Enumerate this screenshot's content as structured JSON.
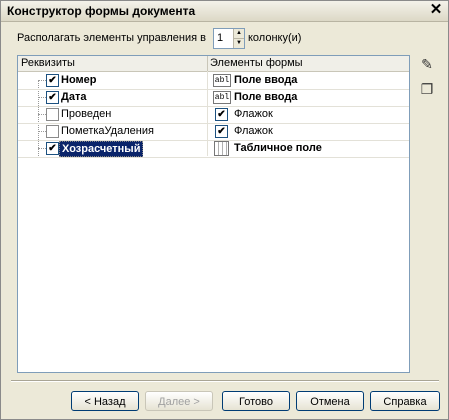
{
  "window": {
    "title": "Конструктор формы документа"
  },
  "arrange": {
    "prefix": "Располагать элементы управления в",
    "columns": "1",
    "suffix": "колонку(и)"
  },
  "grid": {
    "headers": {
      "attributes": "Реквизиты",
      "elements": "Элементы формы"
    },
    "rows": [
      {
        "attribute": "Номер",
        "checked": true,
        "bold": true,
        "element": "Поле ввода",
        "element_checked": null,
        "element_icon": "ab-input-icon",
        "element_bold": true,
        "selected": false
      },
      {
        "attribute": "Дата",
        "checked": true,
        "bold": true,
        "element": "Поле ввода",
        "element_checked": null,
        "element_icon": "ab-input-icon",
        "element_bold": true,
        "selected": false
      },
      {
        "attribute": "Проведен",
        "checked": false,
        "bold": false,
        "element": "Флажок",
        "element_checked": true,
        "element_icon": "checkbox-icon",
        "element_bold": false,
        "selected": false
      },
      {
        "attribute": "ПометкаУдаления",
        "checked": false,
        "bold": false,
        "element": "Флажок",
        "element_checked": true,
        "element_icon": "checkbox-icon",
        "element_bold": false,
        "selected": false
      },
      {
        "attribute": "Хозрасчетный",
        "checked": true,
        "bold": true,
        "element": "Табличное поле",
        "element_checked": null,
        "element_icon": "table-field-icon",
        "element_bold": true,
        "selected": true
      }
    ]
  },
  "input_icon_text": "abl",
  "buttons": {
    "back": "< Назад",
    "next": "Далее >",
    "done": "Готово",
    "cancel": "Отмена",
    "help": "Справка"
  }
}
